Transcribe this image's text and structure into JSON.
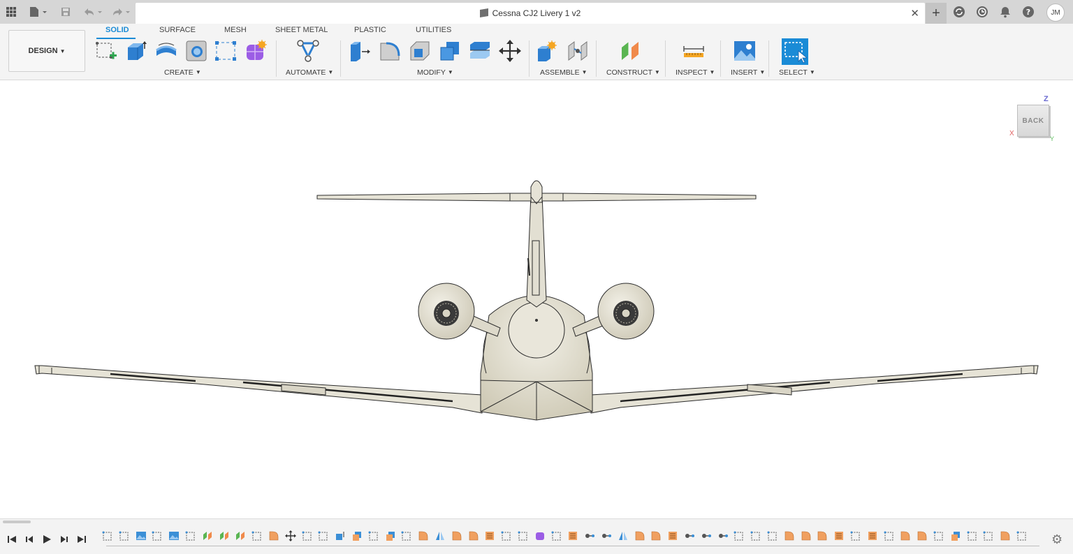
{
  "window": {
    "document_title": "Cessna CJ2 Livery 1 v2",
    "close_glyph": "✕",
    "new_tab_glyph": "+",
    "user_initials": "JM"
  },
  "topbar_icons": [
    "apps-grid-icon",
    "file-icon",
    "save-icon",
    "undo-icon",
    "redo-icon"
  ],
  "right_icons": [
    "extensions-icon",
    "job-status-icon",
    "notifications-icon",
    "help-icon"
  ],
  "workspace": {
    "label": "DESIGN"
  },
  "tabs": [
    {
      "label": "SOLID",
      "active": true
    },
    {
      "label": "SURFACE",
      "active": false
    },
    {
      "label": "MESH",
      "active": false
    },
    {
      "label": "SHEET METAL",
      "active": false
    },
    {
      "label": "PLASTIC",
      "active": false
    },
    {
      "label": "UTILITIES",
      "active": false
    }
  ],
  "groups": {
    "create": "CREATE",
    "automate": "AUTOMATE",
    "modify": "MODIFY",
    "assemble": "ASSEMBLE",
    "construct": "CONSTRUCT",
    "inspect": "INSPECT",
    "insert": "INSERT",
    "select": "SELECT"
  },
  "viewcube": {
    "face": "BACK",
    "z": "Z",
    "x": "X",
    "y": "Y"
  },
  "colors": {
    "accent": "#1a8bd6",
    "model_fill": "#e6e3d6",
    "model_stroke": "#2b2b2b",
    "timeline_orange": "#f0a060",
    "timeline_blue": "#3b8fd6"
  }
}
